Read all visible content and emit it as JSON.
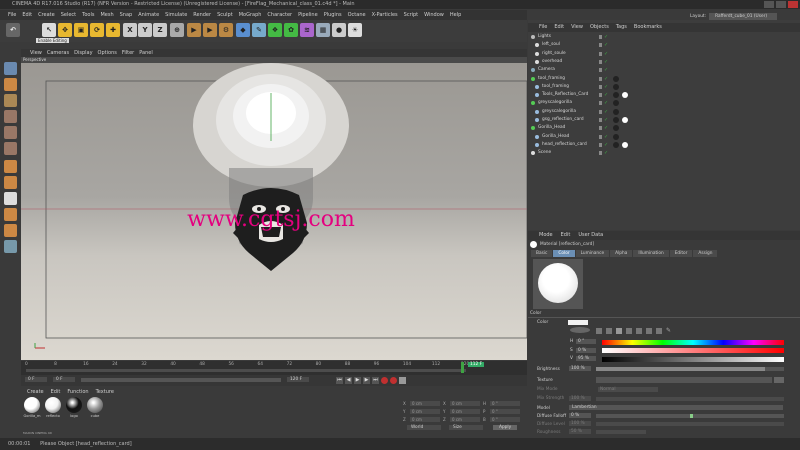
{
  "window": {
    "title": "CINEMA 4D R17.016 Studio (R17) (NFR Version - Restricted License) (Unregistered License) - [FireFlag_Mechanical_class_01.c4d *] - Main"
  },
  "menubar": [
    "File",
    "Edit",
    "Create",
    "Select",
    "Tools",
    "Mesh",
    "Snap",
    "Animate",
    "Simulate",
    "Render",
    "Sculpt",
    "MoGraph",
    "Character",
    "Pipeline",
    "Plugins",
    "Octane",
    "X-Particles",
    "Script",
    "Window",
    "Help"
  ],
  "layout": {
    "label": "Layout:",
    "value": "Rafferdt_cube_01 (User)"
  },
  "toolbar": {
    "tooltip": "Enable Editing",
    "axis": [
      "X",
      "Y",
      "Z"
    ]
  },
  "viewport": {
    "menu": [
      "View",
      "Cameras",
      "Display",
      "Options",
      "Filter",
      "Panel"
    ],
    "title": "Perspective",
    "watermark": "www.cgtsj.com"
  },
  "timeline": {
    "ticks": [
      "0",
      "8",
      "16",
      "24",
      "32",
      "40",
      "48",
      "56",
      "64",
      "72",
      "80",
      "88",
      "96",
      "104",
      "112",
      "120"
    ],
    "current": "112 F",
    "start": "0 F",
    "min": "0 F",
    "end": "120 F",
    "max": "112 F"
  },
  "material_manager": {
    "menu": [
      "Create",
      "Edit",
      "Function",
      "Texture"
    ],
    "materials": [
      {
        "name": "Gorilla_m",
        "color": "#ffffff"
      },
      {
        "name": "reflecto",
        "color": "#f2f2f2"
      },
      {
        "name": "logo",
        "color": "#111111"
      },
      {
        "name": "cube",
        "color": "#9a9a9a"
      }
    ],
    "brand": "MAXON CINEMA 4D"
  },
  "coordinates": {
    "rows": [
      {
        "a": "X",
        "av": "0 cm",
        "b": "X",
        "bv": "0 cm",
        "c": "H",
        "cv": "0 °"
      },
      {
        "a": "Y",
        "av": "0 cm",
        "b": "Y",
        "bv": "0 cm",
        "c": "P",
        "cv": "0 °"
      },
      {
        "a": "Z",
        "av": "0 cm",
        "b": "Z",
        "bv": "0 cm",
        "c": "B",
        "cv": "0 °"
      }
    ],
    "mode1": "World",
    "mode2": "Size",
    "apply": "Apply"
  },
  "object_manager": {
    "menu": [
      "File",
      "Edit",
      "View",
      "Objects",
      "Tags",
      "Bookmarks"
    ],
    "rows": [
      {
        "name": "Lights",
        "indent": 0,
        "icon": "#bbb",
        "tags": 0
      },
      {
        "name": "left_soul",
        "indent": 1,
        "icon": "#ddd",
        "tags": 0
      },
      {
        "name": "right_soule",
        "indent": 1,
        "icon": "#ddd",
        "tags": 0
      },
      {
        "name": "overhead",
        "indent": 1,
        "icon": "#ddd",
        "tags": 0
      },
      {
        "name": "Camera",
        "indent": 0,
        "icon": "#8ab",
        "tags": 0
      },
      {
        "name": "tool_framing",
        "indent": 0,
        "icon": "#5c5",
        "tags": 1
      },
      {
        "name": "tool_framing",
        "indent": 1,
        "icon": "#9bd",
        "tags": 1
      },
      {
        "name": "Tools_Reflection_Card",
        "indent": 1,
        "icon": "#9bd",
        "tags": 2
      },
      {
        "name": "greyscalegorilla",
        "indent": 0,
        "icon": "#5c5",
        "tags": 1
      },
      {
        "name": "greyscalegorilla",
        "indent": 1,
        "icon": "#9bd",
        "tags": 1
      },
      {
        "name": "gsg_reflection_card",
        "indent": 1,
        "icon": "#9bd",
        "tags": 2
      },
      {
        "name": "Gorilla_Head",
        "indent": 0,
        "icon": "#5c5",
        "tags": 1
      },
      {
        "name": "Gorilla_Head",
        "indent": 1,
        "icon": "#9bd",
        "tags": 1
      },
      {
        "name": "head_reflection_card",
        "indent": 1,
        "icon": "#9bd",
        "tags": 2
      },
      {
        "name": "Scene",
        "indent": 0,
        "icon": "#ddd",
        "tags": 0
      }
    ]
  },
  "attributes": {
    "menu": [
      "Mode",
      "Edit",
      "User Data"
    ],
    "title": "Material [reflection_card]",
    "tabs": [
      "Basic",
      "Color",
      "Luminance",
      "Alpha",
      "Illumination",
      "Editor",
      "Assign"
    ],
    "active_tab": "Color",
    "section": "Color",
    "color_label": "Color",
    "hsv": [
      {
        "k": "H",
        "v": "0 °"
      },
      {
        "k": "S",
        "v": "0 %"
      },
      {
        "k": "V",
        "v": "95 %"
      }
    ],
    "brightness_label": "Brightness",
    "brightness_value": "100 %",
    "texture_label": "Texture",
    "mix_mode_label": "Mix Mode",
    "mix_mode_value": "Normal",
    "mix_strength_label": "Mix Strength",
    "mix_strength_value": "100 %",
    "model_label": "Model",
    "model_value": "Lambertian",
    "diffuse_falloff_label": "Diffuse Falloff",
    "diffuse_falloff_value": "0 %",
    "diffuse_level_label": "Diffuse Level",
    "diffuse_level_value": "100 %",
    "roughness_label": "Roughness",
    "roughness_value": "50 %"
  },
  "status": {
    "time": "00:00:01",
    "message": "Please Object [head_reflection_card]"
  },
  "colors": {
    "accent": "#6b8fb5",
    "keyframe": "#3ea343",
    "timeline_red": "#c03030"
  }
}
